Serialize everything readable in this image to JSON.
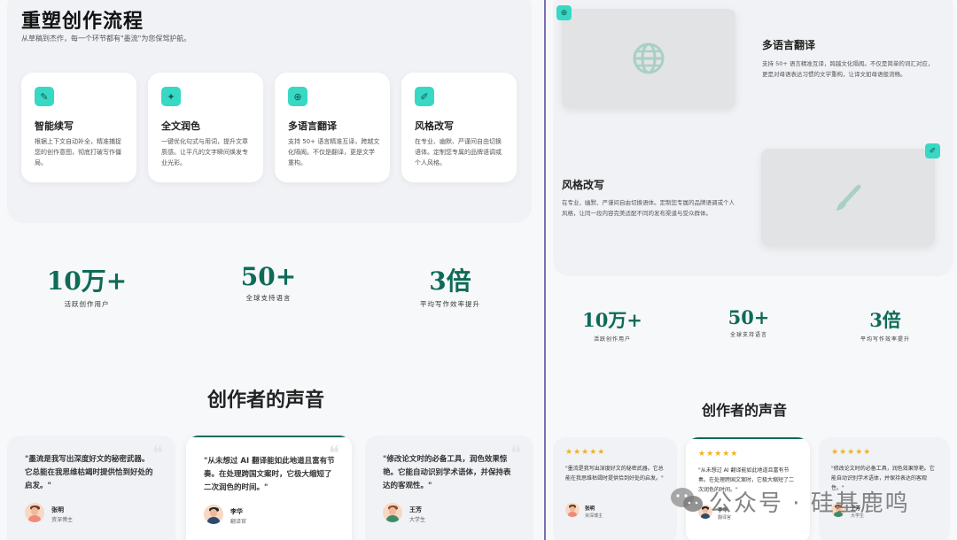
{
  "left": {
    "title": "重塑创作流程",
    "subtitle": "从草稿到杰作，每一个环节都有\"墨流\"为您保驾护航。",
    "features": [
      {
        "icon": "pencil-icon",
        "glyph": "✎",
        "title": "智能续写",
        "desc": "根据上下文自动补全，精准捕捉您的创作意图，彻底打破写作僵局。"
      },
      {
        "icon": "sparkle-icon",
        "glyph": "✦",
        "title": "全文润色",
        "desc": "一键优化句式与用词，提升文章质感。让平凡的文字瞬间焕发专业光彩。"
      },
      {
        "icon": "globe-icon",
        "glyph": "⊕",
        "title": "多语言翻译",
        "desc": "支持 50+ 语言精准互译，跨越文化隔阂。不仅是翻译，更是文学重构。"
      },
      {
        "icon": "brush-icon",
        "glyph": "✐",
        "title": "风格改写",
        "desc": "在专业、幽默、严谨间自由切换语体。定制您专属的品牌语调或个人风格。"
      }
    ],
    "stats": [
      {
        "num": "10万+",
        "label": "活跃创作用户"
      },
      {
        "num": "50+",
        "label": "全球支持语言"
      },
      {
        "num": "3倍",
        "label": "平均写作效率提升"
      }
    ],
    "voices_title": "创作者的声音",
    "testimonials": [
      {
        "text": "\"墨流是我写出深度好文的秘密武器。它总能在我思维枯竭时提供恰到好处的启发。\"",
        "name": "张明",
        "role": "资深博主"
      },
      {
        "text": "\"从未想过 AI 翻译能如此地道且富有节奏。在处理跨国文案时，它极大缩短了二次润色的时间。\"",
        "name": "李华",
        "role": "翻译官"
      },
      {
        "text": "\"修改论文时的必备工具，润色效果惊艳。它能自动识别学术语体，并保持表达的客观性。\"",
        "name": "王芳",
        "role": "大学生"
      }
    ]
  },
  "right": {
    "translate": {
      "title": "多语言翻译",
      "desc": "支持 50+ 语言精准互译，跨越文化隔阂。不仅是简单的词汇对应，更是对母语表达习惯的文学重构，让译文如母语般流畅。"
    },
    "style": {
      "title": "风格改写",
      "desc": "在专业、幽默、严谨间自由切换语体。定制您专属的品牌语调或个人风格，让同一段内容完美适配不同的发布渠道与受众群体。"
    },
    "stats": [
      {
        "num": "10万+",
        "label": "活跃创作用户"
      },
      {
        "num": "50+",
        "label": "全球支持语言"
      },
      {
        "num": "3倍",
        "label": "平均写作效率提升"
      }
    ],
    "voices_title": "创作者的声音",
    "stars": "★★★★★",
    "testimonials": [
      {
        "text": "\"墨流是我写出深度好文的秘密武器。它总能在我思维枯竭时提供恰到好处的启发。\"",
        "name": "张明",
        "role": "资深博主"
      },
      {
        "text": "\"从未想过 AI 翻译能如此地道且富有节奏。在处理跨国文案时，它极大缩短了二次润色的时间。\"",
        "name": "李华",
        "role": "翻译官"
      },
      {
        "text": "\"修改论文时的必备工具，润色效果惊艳。它能自动识别学术语体，并保持表达的客观性。\"",
        "name": "王芳",
        "role": "大学生"
      }
    ]
  },
  "watermark": "公众号 · 硅基鹿鸣",
  "colors": {
    "accent": "#0e6b58",
    "badge": "#37d8c4",
    "star": "#f3b21a",
    "divider": "#7a6fb0"
  }
}
